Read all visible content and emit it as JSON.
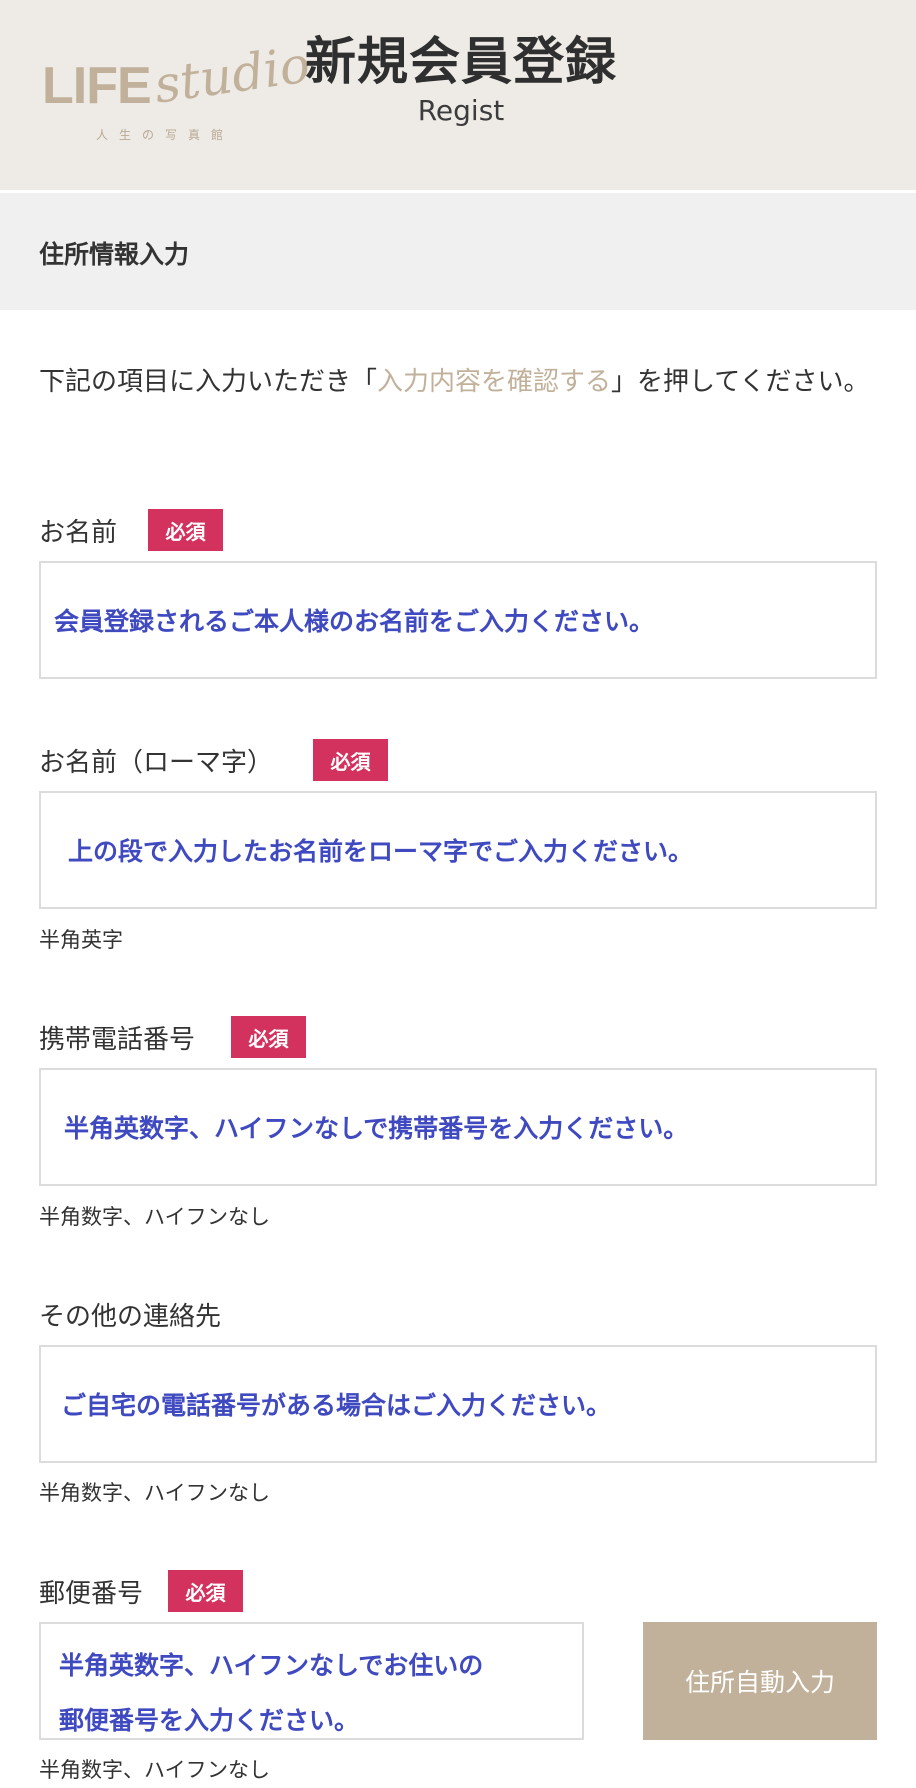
{
  "header": {
    "logo": {
      "brand": "LIFE",
      "script": "studio",
      "tagline": "人生の写真館"
    },
    "title": "新規会員登録",
    "subtitle": "Regist"
  },
  "section": {
    "title": "住所情報入力"
  },
  "intro": {
    "before": "下記の項目に入力いただき「",
    "link": "入力内容を確認する",
    "after": "」を押してください。"
  },
  "fields": [
    {
      "label": "お名前",
      "required": "必須",
      "text": "会員登録されるご本人様のお名前をご入力ください。",
      "hint": ""
    },
    {
      "label": "お名前（ローマ字）",
      "required": "必須",
      "text": "上の段で入力したお名前をローマ字でご入力ください。",
      "hint": "半角英字"
    },
    {
      "label": "携帯電話番号",
      "required": "必須",
      "text": "半角英数字、ハイフンなしで携帯番号を入力ください。",
      "hint": "半角数字、ハイフンなし"
    },
    {
      "label": "その他の連絡先",
      "required": "",
      "text": "ご自宅の電話番号がある場合はご入力ください。",
      "hint": "半角数字、ハイフンなし"
    },
    {
      "label": "郵便番号",
      "required": "必須",
      "text_line1": "半角英数字、ハイフンなしでお住いの",
      "text_line2": "郵便番号を入力ください。",
      "hint": "半角数字、ハイフンなし",
      "button": "住所自動入力"
    }
  ],
  "colors": {
    "accent": "#c2b19a",
    "required_badge": "#d4325e",
    "input_text": "#3f49c0",
    "header_bg": "#eeebe7",
    "section_bg": "#f0f0f0"
  }
}
